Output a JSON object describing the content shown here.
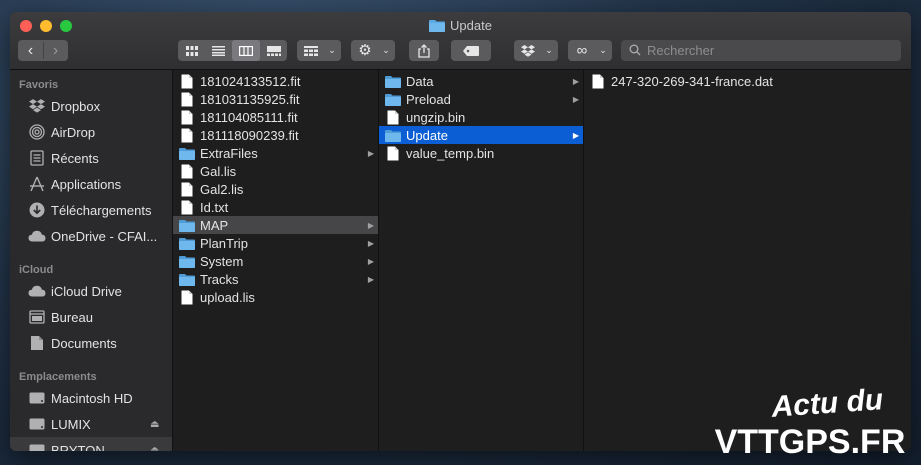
{
  "window": {
    "title": "Update"
  },
  "toolbar": {
    "search_placeholder": "Rechercher"
  },
  "sidebar": {
    "sections": [
      {
        "label": "Favoris",
        "items": [
          {
            "label": "Dropbox",
            "icon": "dropbox-icon"
          },
          {
            "label": "AirDrop",
            "icon": "airdrop-icon"
          },
          {
            "label": "Récents",
            "icon": "recents-icon"
          },
          {
            "label": "Applications",
            "icon": "applications-icon"
          },
          {
            "label": "Téléchargements",
            "icon": "downloads-icon"
          },
          {
            "label": "OneDrive - CFAI...",
            "icon": "cloud-icon"
          }
        ]
      },
      {
        "label": "iCloud",
        "items": [
          {
            "label": "iCloud Drive",
            "icon": "cloud-icon"
          },
          {
            "label": "Bureau",
            "icon": "desktop-icon"
          },
          {
            "label": "Documents",
            "icon": "documents-icon"
          }
        ]
      },
      {
        "label": "Emplacements",
        "items": [
          {
            "label": "Macintosh HD",
            "icon": "disk-icon"
          },
          {
            "label": "LUMIX",
            "icon": "disk-icon",
            "eject": true
          },
          {
            "label": "BRYTON",
            "icon": "disk-icon",
            "eject": true
          }
        ]
      }
    ]
  },
  "columns": [
    {
      "rows": [
        {
          "name": "181024133512.fit",
          "type": "file"
        },
        {
          "name": "181031135925.fit",
          "type": "file"
        },
        {
          "name": "181104085111.fit",
          "type": "file"
        },
        {
          "name": "181118090239.fit",
          "type": "file"
        },
        {
          "name": "ExtraFiles",
          "type": "folder"
        },
        {
          "name": "Gal.lis",
          "type": "file"
        },
        {
          "name": "Gal2.lis",
          "type": "file"
        },
        {
          "name": "Id.txt",
          "type": "file"
        },
        {
          "name": "MAP",
          "type": "folder",
          "selected": "inactive"
        },
        {
          "name": "PlanTrip",
          "type": "folder"
        },
        {
          "name": "System",
          "type": "folder"
        },
        {
          "name": "Tracks",
          "type": "folder"
        },
        {
          "name": "upload.lis",
          "type": "file"
        }
      ]
    },
    {
      "rows": [
        {
          "name": "Data",
          "type": "folder"
        },
        {
          "name": "Preload",
          "type": "folder"
        },
        {
          "name": "ungzip.bin",
          "type": "file"
        },
        {
          "name": "Update",
          "type": "folder",
          "selected": "active"
        },
        {
          "name": "value_temp.bin",
          "type": "file"
        }
      ]
    },
    {
      "rows": [
        {
          "name": "247-320-269-341-france.dat",
          "type": "file"
        }
      ]
    }
  ],
  "watermark": {
    "line1": "Actu du",
    "line2": "VTTGPS.FR"
  },
  "colors": {
    "selection_active": "#0b5ed3",
    "folder": "#5aa8e4"
  }
}
